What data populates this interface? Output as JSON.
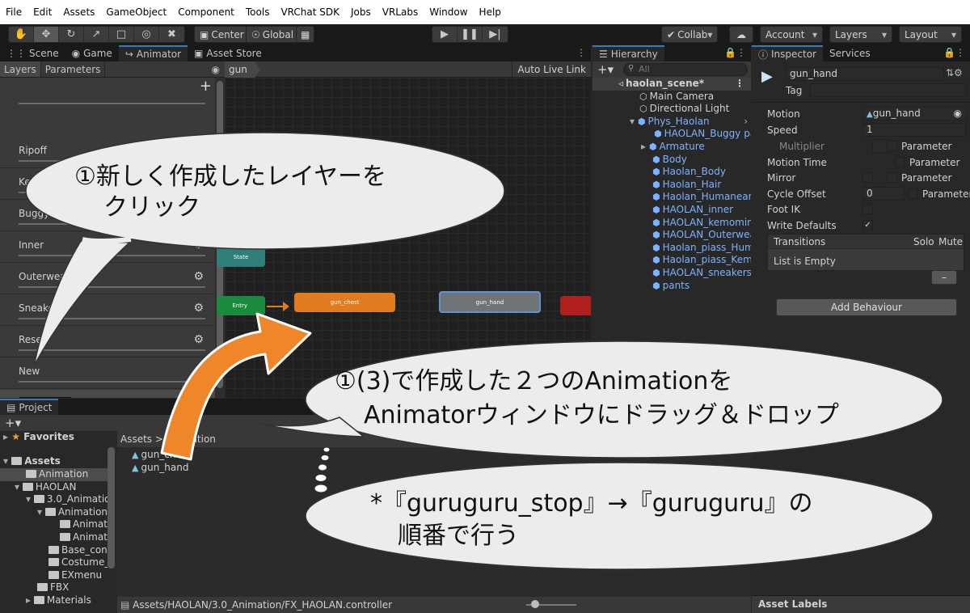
{
  "menu": [
    "File",
    "Edit",
    "Assets",
    "GameObject",
    "Component",
    "Tools",
    "VRChat SDK",
    "Jobs",
    "VRLabs",
    "Window",
    "Help"
  ],
  "toolbar": {
    "pivot": "Center",
    "space": "Global",
    "collab": "Collab",
    "account": "Account",
    "layers": "Layers",
    "layout": "Layout"
  },
  "tabs": {
    "scene": "Scene",
    "game": "Game",
    "animator": "Animator",
    "asset_store": "Asset Store",
    "hierarchy": "Hierarchy",
    "inspector": "Inspector",
    "services": "Services",
    "project": "Project"
  },
  "animator": {
    "sub_tabs": [
      "Layers",
      "Parameters"
    ],
    "breadcrumb": "gun",
    "auto_live_link": "Auto Live Link",
    "layers": [
      "Ripoff",
      "Kemomimi",
      "Buggy pants",
      "Inner",
      "Outerwear",
      "Sneakers",
      "Reset",
      "New"
    ],
    "nodes": {
      "any_state": "State",
      "entry": "Entry",
      "gun_chest": "gun_chest",
      "gun_hand": "gun_hand"
    }
  },
  "hierarchy": {
    "search_placeholder": "All",
    "scene": "haolan_scene*",
    "items": [
      "Main Camera",
      "Directional Light",
      "Phys_Haolan",
      "HAOLAN_Buggy pants",
      "Armature",
      "Body",
      "Haolan_Body",
      "Haolan_Hair",
      "Haolan_Humanear",
      "HAOLAN_inner",
      "HAOLAN_kemomimi",
      "HAOLAN_Outerwear",
      "Haolan_piass_Human",
      "Haolan_piass_Kemo",
      "HAOLAN_sneakers",
      "pants"
    ]
  },
  "inspector": {
    "name": "gun_hand",
    "tag_label": "Tag",
    "motion_label": "Motion",
    "motion_value": "gun_hand",
    "speed_label": "Speed",
    "speed_value": "1",
    "multiplier_label": "Multiplier",
    "parameter_label": "Parameter",
    "motion_time_label": "Motion Time",
    "mirror_label": "Mirror",
    "cycle_offset_label": "Cycle Offset",
    "cycle_offset_value": "0",
    "foot_ik_label": "Foot IK",
    "write_defaults_label": "Write Defaults",
    "transitions_label": "Transitions",
    "solo_label": "Solo",
    "mute_label": "Mute",
    "list_empty": "List is Empty",
    "remove_label": "–",
    "add_behaviour": "Add Behaviour",
    "asset_labels": "Asset Labels"
  },
  "project": {
    "favorites": "Favorites",
    "assets": "Assets",
    "tree": [
      "Animation",
      "HAOLAN",
      "3.0_Animation",
      "Animation",
      "Animati",
      "Animati",
      "Base_cont",
      "Costume_",
      "EXmenu",
      "FBX",
      "Materials"
    ],
    "breadcrumb": "Assets > Animation",
    "files": [
      "gun_chest",
      "gun_hand"
    ],
    "footer_path": "Assets/HAOLAN/3.0_Animation/FX_HAOLAN.controller"
  },
  "callouts": {
    "c1_line1": "①新しく作成したレイヤーを",
    "c1_line2": "クリック",
    "c2_line1": "①(3)で作成した２つのAnimationを",
    "c2_line2": "Animatorウィンドウにドラッグ＆ドロップ",
    "c3_line1": "*『guruguru_stop』→『guruguru』の",
    "c3_line2": "順番で行う"
  },
  "colors": {
    "accent": "#3a79bb",
    "node_orange": "#e07b1f",
    "node_grey": "#6f7479",
    "node_green": "#1c8a3c",
    "node_red": "#b01e1e",
    "node_teal": "#2f7f78",
    "arrow": "#f0862a"
  }
}
